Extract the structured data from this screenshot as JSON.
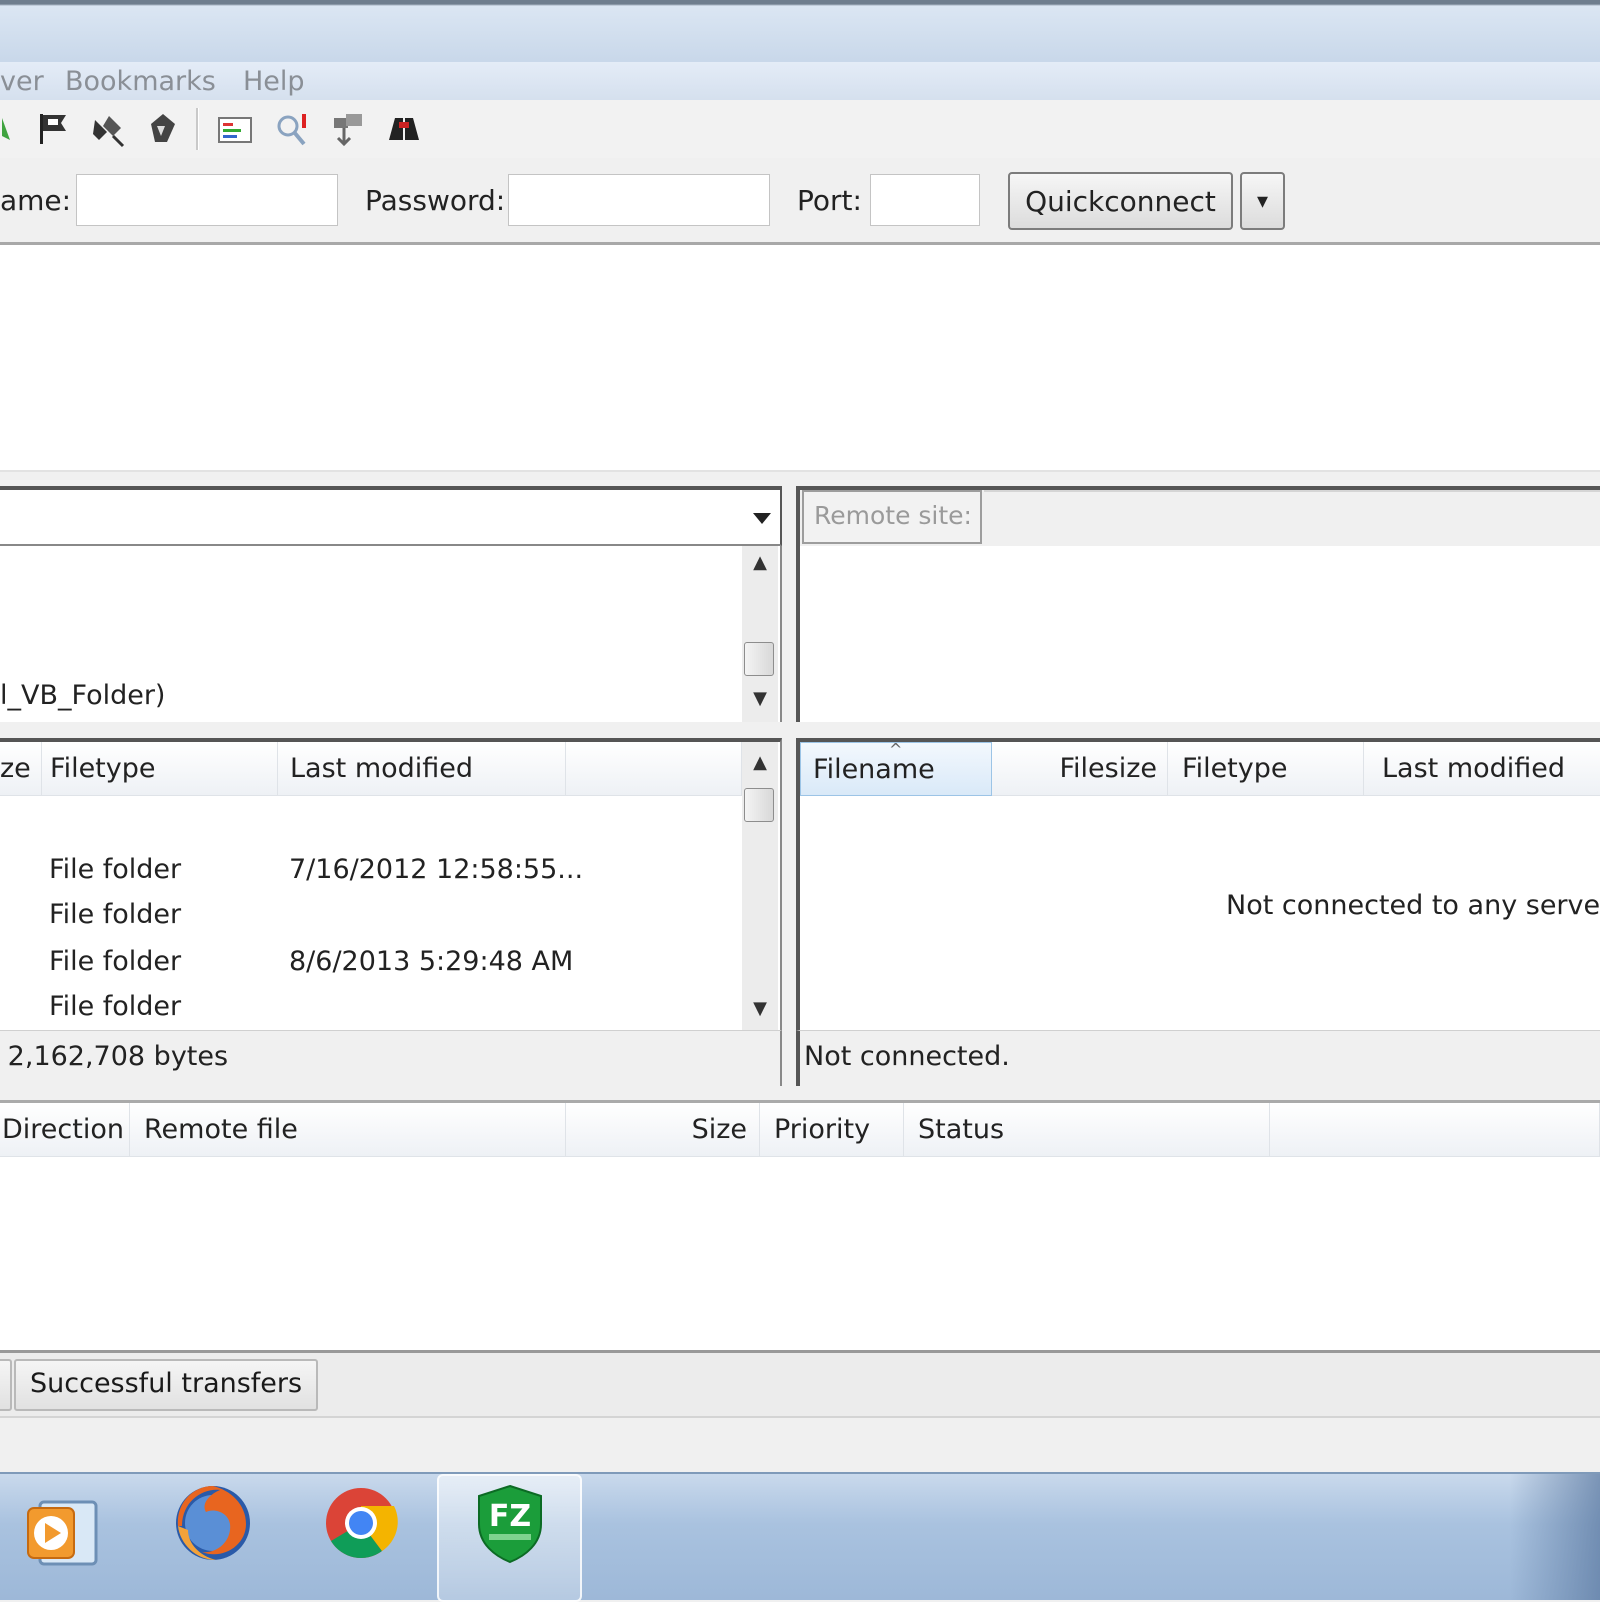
{
  "menu": [
    "ver",
    "Bookmarks",
    "Help"
  ],
  "toolbar_icons": [
    "process-queue-icon",
    "flag-icon",
    "disconnect-icon",
    "reconnect-icon",
    "directory-listing-filter-icon",
    "sync-browse-icon",
    "compare-dirs-icon",
    "search-files-icon"
  ],
  "quickconnect": {
    "username_label": "ame:",
    "username_value": "",
    "password_label": "Password:",
    "password_value": "",
    "port_label": "Port:",
    "port_value": "",
    "button_label": "Quickconnect",
    "dropdown_glyph": "▾"
  },
  "local": {
    "tree_visible_item": "l_VB_Folder)",
    "columns": [
      "ze",
      "Filetype",
      "Last modified",
      ""
    ],
    "rows": [
      {
        "filetype": "File folder",
        "modified": "7/16/2012 12:58:55..."
      },
      {
        "filetype": "File folder",
        "modified": ""
      },
      {
        "filetype": "File folder",
        "modified": "8/6/2013 5:29:48 AM"
      },
      {
        "filetype": "File folder",
        "modified": ""
      }
    ],
    "status": ": 2,162,708 bytes"
  },
  "remote": {
    "site_label": "Remote site:",
    "columns": [
      "Filename",
      "Filesize",
      "Filetype",
      "Last modified"
    ],
    "empty_message": "Not connected to any serve",
    "status": "Not connected."
  },
  "queue": {
    "columns": [
      "Direction",
      "Remote file",
      "Size",
      "Priority",
      "Status",
      ""
    ],
    "tabs": [
      "",
      "Successful transfers"
    ]
  },
  "taskbar": {
    "apps": [
      "media-player-icon",
      "firefox-icon",
      "chrome-icon",
      "filezilla-icon"
    ],
    "filezilla_badge": "FZ"
  },
  "colors": {
    "accent": "#3a6ea5",
    "sorted_header": "#e3eef9"
  }
}
